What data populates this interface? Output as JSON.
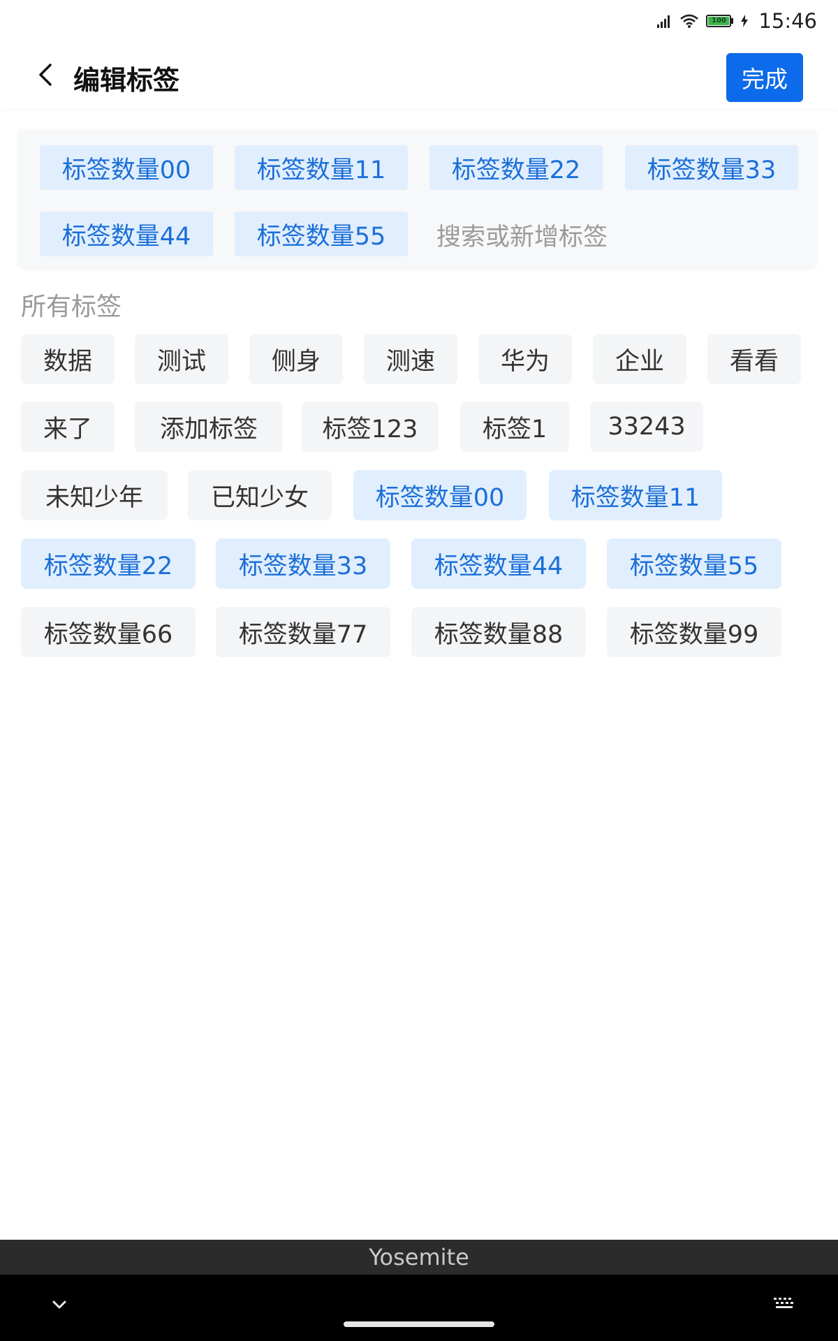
{
  "status_bar": {
    "time": "15:46",
    "battery_percent": "100",
    "icons": [
      "signal-icon",
      "wifi-icon",
      "battery-icon",
      "charging-icon"
    ]
  },
  "header": {
    "title": "编辑标签",
    "done_label": "完成",
    "back_icon": "chevron-left-icon"
  },
  "selected": {
    "tags": [
      "标签数量00",
      "标签数量11",
      "标签数量22",
      "标签数量33",
      "标签数量44",
      "标签数量55"
    ],
    "search_placeholder": "搜索或新增标签"
  },
  "all_tags": {
    "label": "所有标签",
    "tags": [
      {
        "text": "数据",
        "selected": false
      },
      {
        "text": "测试",
        "selected": false
      },
      {
        "text": "侧身",
        "selected": false
      },
      {
        "text": "测速",
        "selected": false
      },
      {
        "text": "华为",
        "selected": false
      },
      {
        "text": "企业",
        "selected": false
      },
      {
        "text": "看看",
        "selected": false
      },
      {
        "text": "来了",
        "selected": false
      },
      {
        "text": "添加标签",
        "selected": false
      },
      {
        "text": "标签123",
        "selected": false
      },
      {
        "text": "标签1",
        "selected": false
      },
      {
        "text": "33243",
        "selected": false
      },
      {
        "text": "未知少年",
        "selected": false
      },
      {
        "text": "已知少女",
        "selected": false
      },
      {
        "text": "标签数量00",
        "selected": true
      },
      {
        "text": "标签数量11",
        "selected": true
      },
      {
        "text": "标签数量22",
        "selected": true
      },
      {
        "text": "标签数量33",
        "selected": true
      },
      {
        "text": "标签数量44",
        "selected": true
      },
      {
        "text": "标签数量55",
        "selected": true
      },
      {
        "text": "标签数量66",
        "selected": false
      },
      {
        "text": "标签数量77",
        "selected": false
      },
      {
        "text": "标签数量88",
        "selected": false
      },
      {
        "text": "标签数量99",
        "selected": false
      }
    ]
  },
  "keyboard": {
    "suggestion": "Yosemite"
  },
  "colors": {
    "accent": "#0b6bea",
    "selected_tag_bg": "#e1eefd",
    "selected_tag_text": "#1b6fd8",
    "normal_tag_bg": "#f4f5f7"
  }
}
